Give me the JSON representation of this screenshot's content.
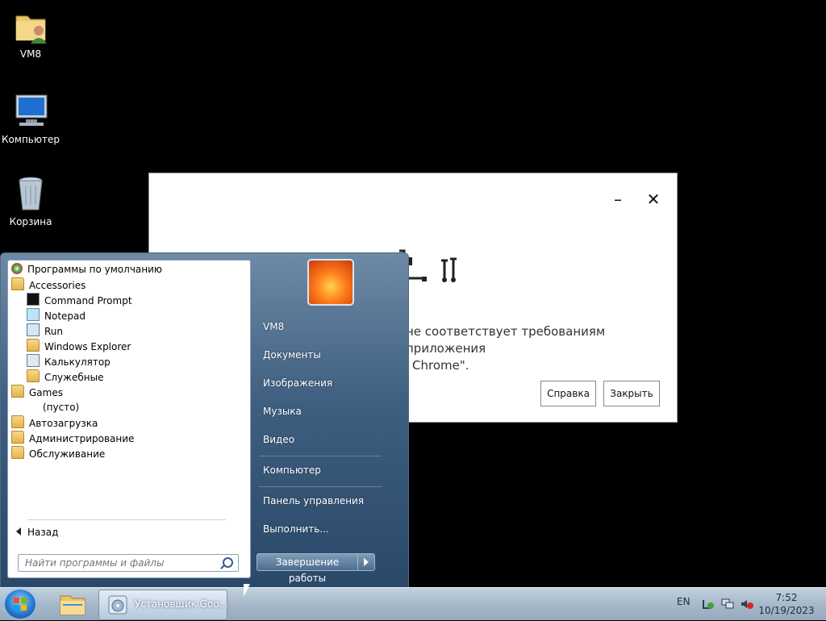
{
  "desktop": {
    "icons": [
      {
        "label": "VM8",
        "icon": "user-folder-icon"
      },
      {
        "label": "Компьютер",
        "icon": "computer-icon"
      },
      {
        "label": "Корзина",
        "icon": "recycle-bin-icon"
      }
    ]
  },
  "dialog": {
    "message_line1": "не соответствует требованиям приложения",
    "message_line2": "Chrome\".",
    "help_button": "Справка",
    "close_button": "Закрыть",
    "minimize_glyph": "–",
    "close_glyph": "✕"
  },
  "start_menu": {
    "programs": [
      {
        "label": "Программы по умолчанию",
        "icon": "default-programs-icon",
        "indent": 0
      },
      {
        "label": "Accessories",
        "icon": "folder-icon",
        "indent": 0
      },
      {
        "label": "Command Prompt",
        "icon": "cmd-icon",
        "indent": 1
      },
      {
        "label": "Notepad",
        "icon": "notepad-icon",
        "indent": 1
      },
      {
        "label": "Run",
        "icon": "run-icon",
        "indent": 1
      },
      {
        "label": "Windows Explorer",
        "icon": "explorer-icon",
        "indent": 1
      },
      {
        "label": "Калькулятор",
        "icon": "calculator-icon",
        "indent": 1
      },
      {
        "label": "Служебные",
        "icon": "folder-icon",
        "indent": 1
      },
      {
        "label": "Games",
        "icon": "folder-icon",
        "indent": 0
      },
      {
        "label": "(пусто)",
        "icon": "",
        "indent": 1
      },
      {
        "label": "Автозагрузка",
        "icon": "folder-icon",
        "indent": 0
      },
      {
        "label": "Администрирование",
        "icon": "folder-icon",
        "indent": 0
      },
      {
        "label": "Обслуживание",
        "icon": "folder-icon",
        "indent": 0
      }
    ],
    "back_label": "Назад",
    "search_placeholder": "Найти программы и файлы",
    "right_items": [
      "VM8",
      "Документы",
      "Изображения",
      "Музыка",
      "Видео",
      "Компьютер",
      "Панель управления",
      "Выполнить..."
    ],
    "shutdown_label": "Завершение работы"
  },
  "taskbar": {
    "installer_label": "Установщик Goo...",
    "language": "EN",
    "time": "7:52",
    "date": "10/19/2023"
  }
}
